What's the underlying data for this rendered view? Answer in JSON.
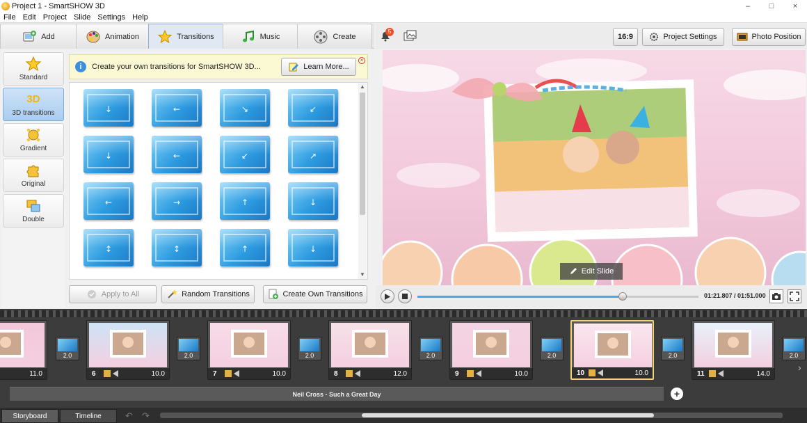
{
  "window": {
    "title": "Project 1 - SmartSHOW 3D",
    "controls": [
      "–",
      "□",
      "×"
    ]
  },
  "menu": [
    "File",
    "Edit",
    "Project",
    "Slide",
    "Settings",
    "Help"
  ],
  "tabs": [
    {
      "label": "Add",
      "icon": "add-photo-icon"
    },
    {
      "label": "Animation",
      "icon": "palette-icon"
    },
    {
      "label": "Transitions",
      "icon": "star-icon"
    },
    {
      "label": "Music",
      "icon": "music-note-icon"
    },
    {
      "label": "Create",
      "icon": "film-reel-icon"
    }
  ],
  "categories": [
    {
      "label": "Standard",
      "icon": "star-icon"
    },
    {
      "label": "3D transitions",
      "icon": "3d-icon",
      "glyph": "3D"
    },
    {
      "label": "Gradient",
      "icon": "gradient-icon"
    },
    {
      "label": "Original",
      "icon": "puzzle-icon"
    },
    {
      "label": "Double",
      "icon": "double-icon"
    }
  ],
  "banner": {
    "text": "Create your own transitions for SmartSHOW 3D...",
    "button": "Learn More..."
  },
  "actions": {
    "apply_all": "Apply to All",
    "random": "Random Transitions",
    "create_own": "Create Own Transitions"
  },
  "toolbar": {
    "notifications": "5",
    "aspect": "16:9",
    "project_settings": "Project Settings",
    "photo_position": "Photo Position"
  },
  "preview": {
    "edit_slide": "Edit Slide"
  },
  "player": {
    "time": "01:21.807 / 01:51.000",
    "progress": 0.73
  },
  "storyboard": {
    "slides": [
      {
        "num": "",
        "duration": "11.0"
      },
      {
        "num": "6",
        "duration": "10.0"
      },
      {
        "num": "7",
        "duration": "10.0"
      },
      {
        "num": "8",
        "duration": "12.0"
      },
      {
        "num": "9",
        "duration": "10.0"
      },
      {
        "num": "10",
        "duration": "10.0",
        "active": true
      },
      {
        "num": "11",
        "duration": "14.0"
      }
    ],
    "transitions": [
      "2.0",
      "2.0",
      "2.0",
      "2.0",
      "2.0",
      "2.0",
      "2.0"
    ],
    "music": "Neil Cross - Such a Great Day",
    "tabs": [
      "Storyboard",
      "Timeline"
    ]
  },
  "colors": {
    "accent": "#2d9be0",
    "active_tab": "#dfe8f3",
    "active_slide": "#f3d37a"
  }
}
